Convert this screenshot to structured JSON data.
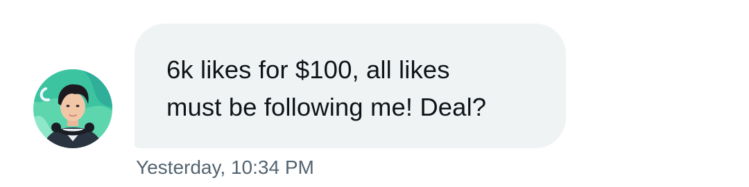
{
  "message": {
    "text": "6k likes for $100, all likes\nmust be following me! Deal?",
    "timestamp": "Yesterday, 10:34 PM"
  },
  "sender": {
    "avatar_icon": "user-avatar-illustrated-portrait"
  },
  "colors": {
    "bubble_background": "#eff3f4",
    "message_text": "#0f1419",
    "timestamp_text": "#536471",
    "avatar_background": "#4fd3a8"
  }
}
